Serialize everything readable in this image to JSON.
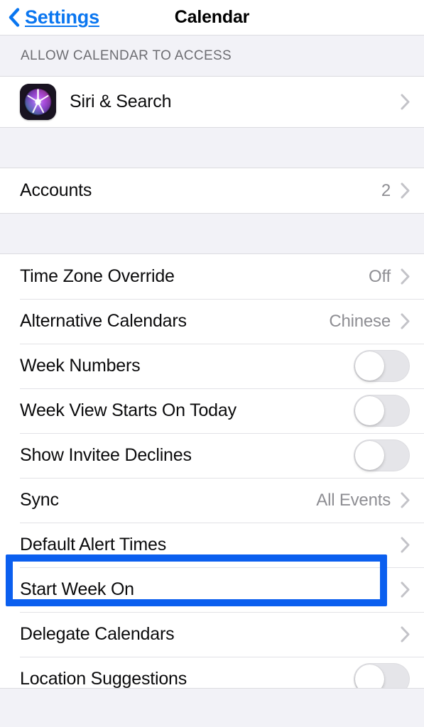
{
  "navbar": {
    "back_label": "Settings",
    "back_icon": "chevron-left-icon",
    "title": "Calendar"
  },
  "sections": [
    {
      "header": "ALLOW CALENDAR TO ACCESS",
      "rows": [
        {
          "label": "Siri & Search",
          "icon": "siri-icon",
          "accessory": "chevron",
          "value": ""
        }
      ]
    },
    {
      "header": "",
      "rows": [
        {
          "label": "Accounts",
          "accessory": "chevron",
          "value": "2"
        }
      ]
    },
    {
      "header": "",
      "rows": [
        {
          "label": "Time Zone Override",
          "accessory": "chevron",
          "value": "Off"
        },
        {
          "label": "Alternative Calendars",
          "accessory": "chevron",
          "value": "Chinese"
        },
        {
          "label": "Week Numbers",
          "accessory": "toggle",
          "toggle_on": false
        },
        {
          "label": "Week View Starts On Today",
          "accessory": "toggle",
          "toggle_on": false
        },
        {
          "label": "Show Invitee Declines",
          "accessory": "toggle",
          "toggle_on": false
        },
        {
          "label": "Sync",
          "accessory": "chevron",
          "value": "All Events"
        },
        {
          "label": "Default Alert Times",
          "accessory": "chevron",
          "value": ""
        },
        {
          "label": "Start Week On",
          "accessory": "chevron",
          "value": "",
          "highlighted": true
        },
        {
          "label": "Delegate Calendars",
          "accessory": "chevron",
          "value": ""
        },
        {
          "label": "Location Suggestions",
          "accessory": "toggle",
          "toggle_on": false
        }
      ]
    }
  ],
  "colors": {
    "accent_blue": "#0a76f0",
    "annotation_blue": "#0b5fef",
    "page_background": "#f2f2f7",
    "row_background": "#ffffff",
    "secondary_text": "#8e8e93",
    "chevron_gray": "#c3c3c8",
    "toggle_off_track": "#e5e5e9"
  }
}
